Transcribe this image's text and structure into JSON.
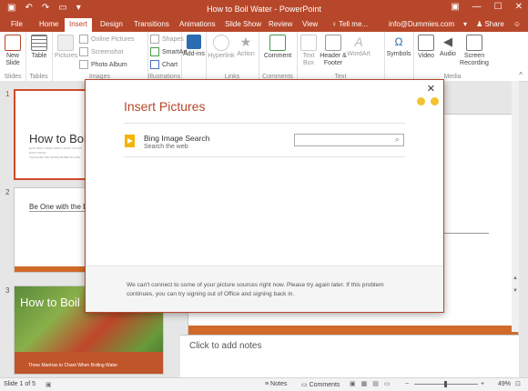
{
  "window": {
    "title": "How to Boil Water - PowerPoint"
  },
  "tabs": [
    "File",
    "Home",
    "Insert",
    "Design",
    "Transitions",
    "Animations",
    "Slide Show",
    "Review",
    "View"
  ],
  "active_tab": "Insert",
  "tell_me": "Tell me...",
  "account": "info@Dummies.com",
  "share_label": "Share",
  "ribbon": {
    "new_slide": "New Slide",
    "table": "Table",
    "pictures": "Pictures",
    "online_pictures": "Online Pictures",
    "screenshot": "Screenshot",
    "photo_album": "Photo Album",
    "shapes": "Shapes",
    "smartart": "SmartArt",
    "chart": "Chart",
    "addins": "Add-ins",
    "hyperlink": "Hyperlink",
    "action": "Action",
    "comment": "Comment",
    "text_box": "Text Box",
    "header_footer": "Header & Footer",
    "wordart": "WordArt",
    "symbols": "Symbols",
    "video": "Video",
    "audio": "Audio",
    "screen_recording": "Screen Recording",
    "groups": {
      "slides": "Slides",
      "tables": "Tables",
      "images": "Images",
      "illustrations": "Illustrations",
      "links": "Links",
      "comments": "Comments",
      "text": "Text",
      "media": "Media"
    }
  },
  "thumbnails": [
    {
      "num": "1",
      "title": "How to Boil",
      "lines": [
        "EASY BOIL STEPS ABOUT HOW YOU DO",
        "DON'T PANIC",
        "VISUALIZE THE WATER BUBBLING AND"
      ]
    },
    {
      "num": "2",
      "title": "Be One with the Bo"
    },
    {
      "num": "3",
      "title": "How to Boil",
      "caption": "Three Mantras to Chant When Boiling Water"
    }
  ],
  "notes_placeholder": "Click to add notes",
  "status": {
    "slide": "Slide 1 of 5",
    "notes": "Notes",
    "comments": "Comments",
    "zoom": "49%"
  },
  "dialog": {
    "title": "Insert Pictures",
    "source_name": "Bing Image Search",
    "source_desc": "Search the web",
    "search_placeholder": "",
    "message": "We can't connect to some of your picture sources right now. Please try again later. If this problem continues, you can try signing out of Office and signing back in."
  },
  "colors": {
    "accent": "#b7472a",
    "ribbon_bg": "#ffffff",
    "workspace_bg": "#e6e6e6",
    "bing": "#f4b400"
  }
}
